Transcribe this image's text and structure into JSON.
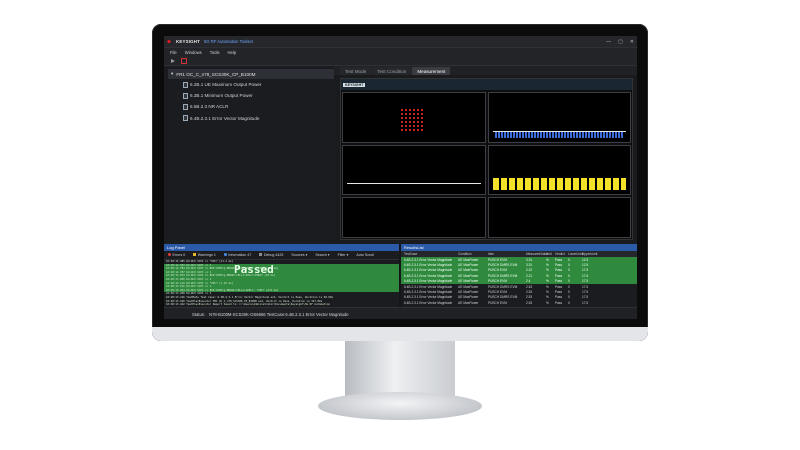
{
  "app": {
    "brand": "KEYSIGHT",
    "title": "5G RF Automation Toolset",
    "window_controls": [
      "—",
      "▢",
      "✕"
    ]
  },
  "menu": [
    "File",
    "Windows",
    "Tools",
    "Help"
  ],
  "tree": {
    "root": "FR1 OC_C_n78_SCS30K_CP_B100M",
    "items": [
      "6.2B.1 UE Maximum Output Power",
      "6.3B.1 Minimum Output Power",
      "6.5B.2.3 NR ACLR",
      "6.4B.2.3.1 Error Vector Magnitude"
    ]
  },
  "tabs": [
    "Test Mode",
    "Test Condition",
    "Measurement"
  ],
  "measurement": {
    "brand": "KEYSIGHT"
  },
  "log_panel": {
    "title": "Log Panel",
    "errors": "Errors 0",
    "warnings": "Warnings 1",
    "information": "Information 47",
    "debug": "Debug 4425",
    "sources": "Sources ▾",
    "search": "Search ▾",
    "filter": "Filter ▾",
    "auto_scroll": "Auto Scroll",
    "passed": "Passed",
    "lines": [
      {
        "text": "16:48:12.485  DU-RCO     SCPI >> *OPC? [11.2 ms]",
        "green": false
      },
      {
        "text": "16:48:12.503  DU-RCO     SCPI << 1",
        "green": true
      },
      {
        "text": "16:48:12.784  DU-RCO     SCPI >> BSE:CONFig:NRSUb:CELL1:APPLY; *OPC? [262 ms]",
        "green": true
      },
      {
        "text": "16:48:12.787  DU-RCO     SCPI << 1",
        "green": true
      },
      {
        "text": "16:48:13.054  DU-RCO     SCPI >> BSE:CONFig:NRSUb:CELL1:PUSch:PZRO? [18 ms]",
        "green": true
      },
      {
        "text": "16:48:13.068  DU-RCO     SCPI << 1",
        "green": true
      },
      {
        "text": "16:48:13.119  DU-RCO     SCPI >> *OPC? [1.45 ms]",
        "green": true
      },
      {
        "text": "16:48:13.221  DU-RCO     SCPI << 1",
        "green": true
      },
      {
        "text": "16:48:13.264  DU-RCO     SCPI >> BSE:CONFig:NRSUb:CELL1:APPLY; *OPC? [271 ms]",
        "green": true
      },
      {
        "text": "16:48:13.268  DU-RCO     SCPI << 1",
        "green": false
      },
      {
        "text": "16:48:13.416  TestMode   Test Case: 6.4B.2.3.1 Error Vector Magnitude end, Verdict is Pass, Duration is 69.60s",
        "green": false
      },
      {
        "text": "16:48:13.420  TestPlanExecutor  FR1 OC_C_n78_SCS30K_CP_B100M end, Verdict is Pass, Duration is 327.89s",
        "green": false
      },
      {
        "text": "16:48:13.422  TestPlanExecutor  Report Saved to: C:\\Users\\Administrator\\Documents\\Keysight\\5G RF Automation",
        "green": false
      },
      {
        "text": "16:48:13.425  TestPlanExecutor  Test test 3/3 end, Verdict is Pass, Duration is 398.51s",
        "green": false
      }
    ]
  },
  "results": {
    "title": "ResultsList",
    "headers": [
      "TestCase",
      "Condition",
      "Item",
      "MeasuredValue",
      "Unit",
      "Verdict",
      "LowerLimit",
      "UpperLimit"
    ],
    "rows": [
      {
        "cells": [
          "6.4B.2.3.1 Error Vector Magnitude",
          "UE MaxPower",
          "PUSCH EVM",
          "3.31",
          "%",
          "Pass",
          "0",
          "12.5"
        ],
        "green": true
      },
      {
        "cells": [
          "6.4B.2.3.1 Error Vector Magnitude",
          "UE MaxPower",
          "PUSCH DMRS EVM",
          "3.31",
          "%",
          "Pass",
          "0",
          "12.5"
        ],
        "green": true
      },
      {
        "cells": [
          "6.4B.2.3.1 Error Vector Magnitude",
          "UE MaxPower",
          "PUSCH EVM",
          "2.22",
          "%",
          "Pass",
          "0",
          "17.5"
        ],
        "green": true
      },
      {
        "cells": [
          "6.4B.2.3.1 Error Vector Magnitude",
          "UE MaxPower",
          "PUSCH DMRS EVM",
          "2.21",
          "%",
          "Pass",
          "0",
          "17.5"
        ],
        "green": true
      },
      {
        "cells": [
          "6.4B.2.3.1 Error Vector Magnitude",
          "UE MaxPower",
          "PUSCH EVM",
          "2.4",
          "%",
          "Pass",
          "0",
          "17.5"
        ],
        "green": true
      },
      {
        "cells": [
          "6.4B.2.3.1 Error Vector Magnitude",
          "UE MaxPower",
          "PUSCH DMRS EVM",
          "2.53",
          "%",
          "Pass",
          "0",
          "17.5"
        ],
        "green": false
      },
      {
        "cells": [
          "6.4B.2.3.1 Error Vector Magnitude",
          "UE MaxPower",
          "PUSCH EVM",
          "2.53",
          "%",
          "Pass",
          "0",
          "17.5"
        ],
        "green": false
      },
      {
        "cells": [
          "6.4B.2.3.1 Error Vector Magnitude",
          "UE MaxPower",
          "PUSCH DMRS EVM",
          "2.53",
          "%",
          "Pass",
          "0",
          "17.5"
        ],
        "green": false
      },
      {
        "cells": [
          "6.4B.2.3.1 Error Vector Magnitude",
          "UE MaxPower",
          "PUSCH EVM",
          "2.53",
          "%",
          "Pass",
          "0",
          "17.5"
        ],
        "green": false
      }
    ]
  },
  "status": {
    "label": "Status:",
    "text": "N78-B100M-SCS30K-OS6666 TestCase:6.4B.2.3.1 Error Vector Magnitude"
  }
}
